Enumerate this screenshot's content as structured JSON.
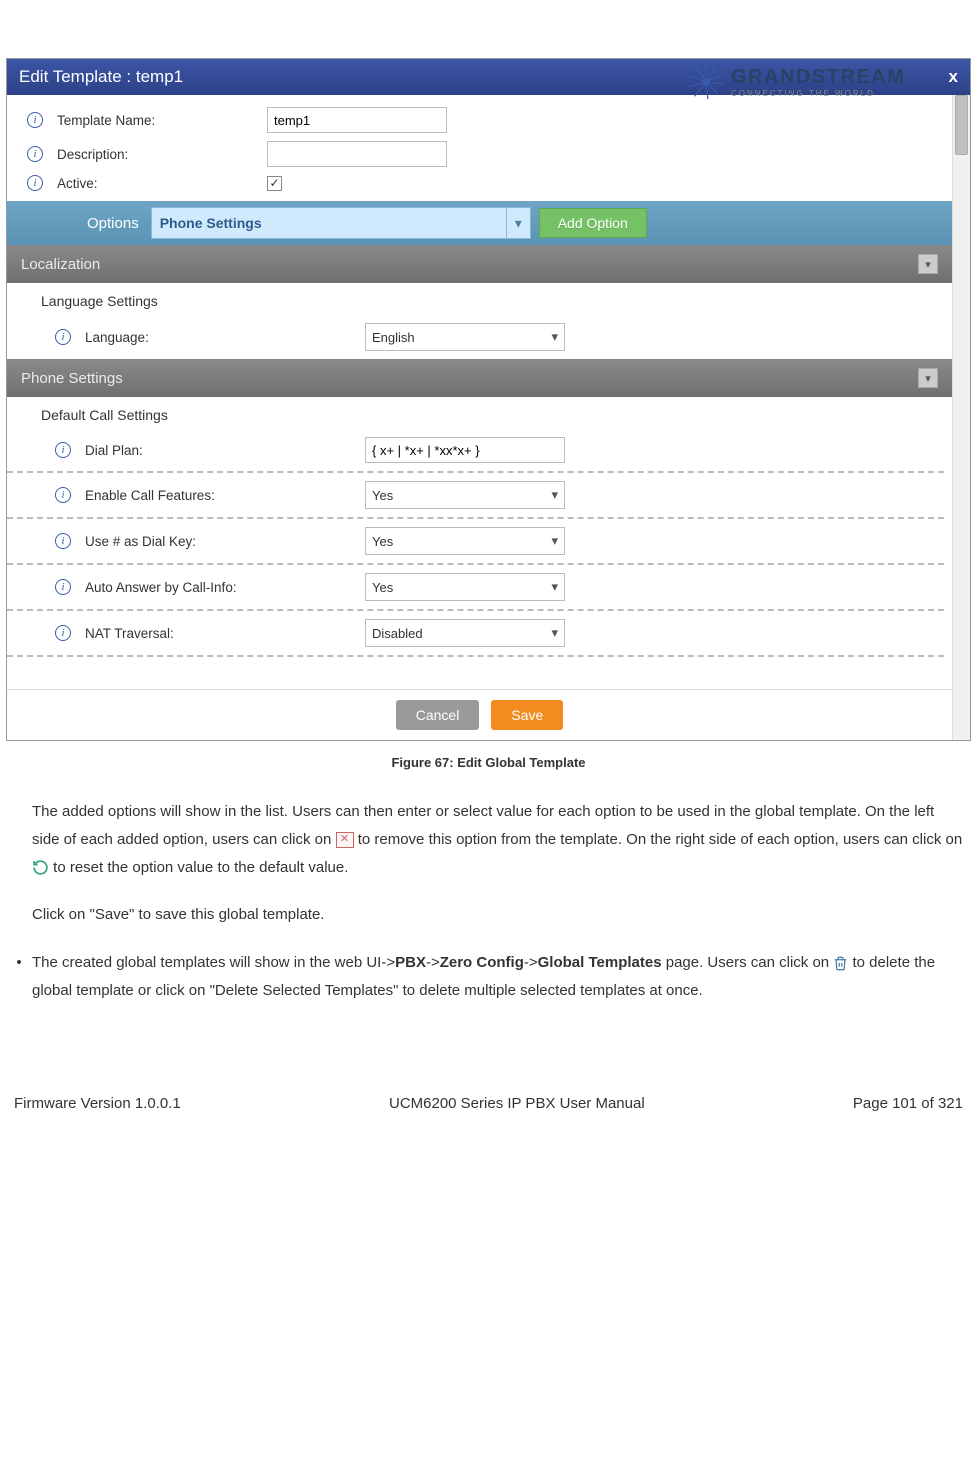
{
  "logo": {
    "name": "GRANDSTREAM",
    "tagline": "CONNECTING THE WORLD"
  },
  "dialog": {
    "title": "Edit Template : temp1",
    "close": "x",
    "fields": {
      "template_name_label": "Template Name:",
      "template_name_value": "temp1",
      "description_label": "Description:",
      "description_value": "",
      "active_label": "Active:",
      "active_checked": "✓"
    },
    "options": {
      "label": "Options",
      "dropdown_value": "Phone Settings",
      "add_button": "Add Option"
    },
    "sections": {
      "localization": {
        "title": "Localization",
        "sub": "Language Settings",
        "language_label": "Language:",
        "language_value": "English"
      },
      "phone": {
        "title": "Phone Settings",
        "sub": "Default Call Settings",
        "rows": [
          {
            "label": "Dial Plan:",
            "value": "{ x+ | *x+ | *xx*x+ }",
            "type": "text"
          },
          {
            "label": "Enable Call Features:",
            "value": "Yes",
            "type": "select"
          },
          {
            "label": "Use # as Dial Key:",
            "value": "Yes",
            "type": "select"
          },
          {
            "label": "Auto Answer by Call-Info:",
            "value": "Yes",
            "type": "select"
          },
          {
            "label": "NAT Traversal:",
            "value": "Disabled",
            "type": "select"
          }
        ]
      }
    },
    "footer": {
      "cancel": "Cancel",
      "save": "Save"
    }
  },
  "caption": "Figure 67: Edit Global Template",
  "paragraphs": {
    "p1a": "The added options will show in the list. Users can then enter or select value for each option to be used in the global template. On the left side of each added option, users can click on ",
    "p1b": " to remove this option from the template. On the right side of each option, users can click on ",
    "p1c": " to reset the option value to the default value.",
    "p2": "Click on \"Save\" to save this global template.",
    "bullet_a": "The created global templates will show in the web UI->",
    "bullet_b": "PBX",
    "bullet_c": "->",
    "bullet_d": "Zero Config",
    "bullet_e": "->",
    "bullet_f": "Global Templates",
    "bullet_g": " page. Users can click on ",
    "bullet_h": " to delete the global template or click on \"Delete Selected Templates\" to delete multiple selected templates at once."
  },
  "footer": {
    "left": "Firmware Version 1.0.0.1",
    "center": "UCM6200 Series IP PBX User Manual",
    "right": "Page 101 of 321"
  }
}
